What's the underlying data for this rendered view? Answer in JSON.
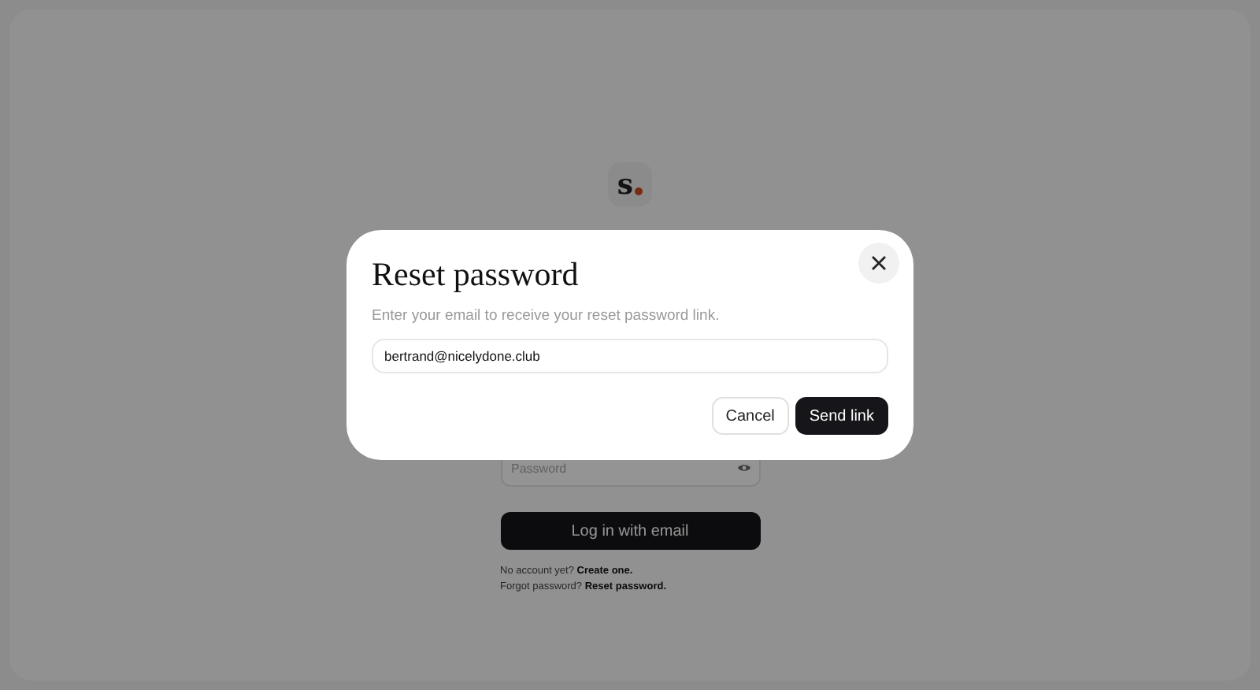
{
  "login": {
    "logo": "s",
    "password_field": {
      "placeholder": "Password"
    },
    "login_button": "Log in with email",
    "signup_text": "No account yet? **Create one.**",
    "reset_text": "Forgot password? **Reset password.**"
  },
  "dialog": {
    "title": "Reset password",
    "description": "Enter your email to receive your reset password link.",
    "email_field": {
      "value": "bertrand@nicelydone.club"
    },
    "buttons": [
      {
        "label": "Cancel",
        "kind": "secondary"
      },
      {
        "label": "Send link",
        "kind": "primary"
      }
    ]
  }
}
